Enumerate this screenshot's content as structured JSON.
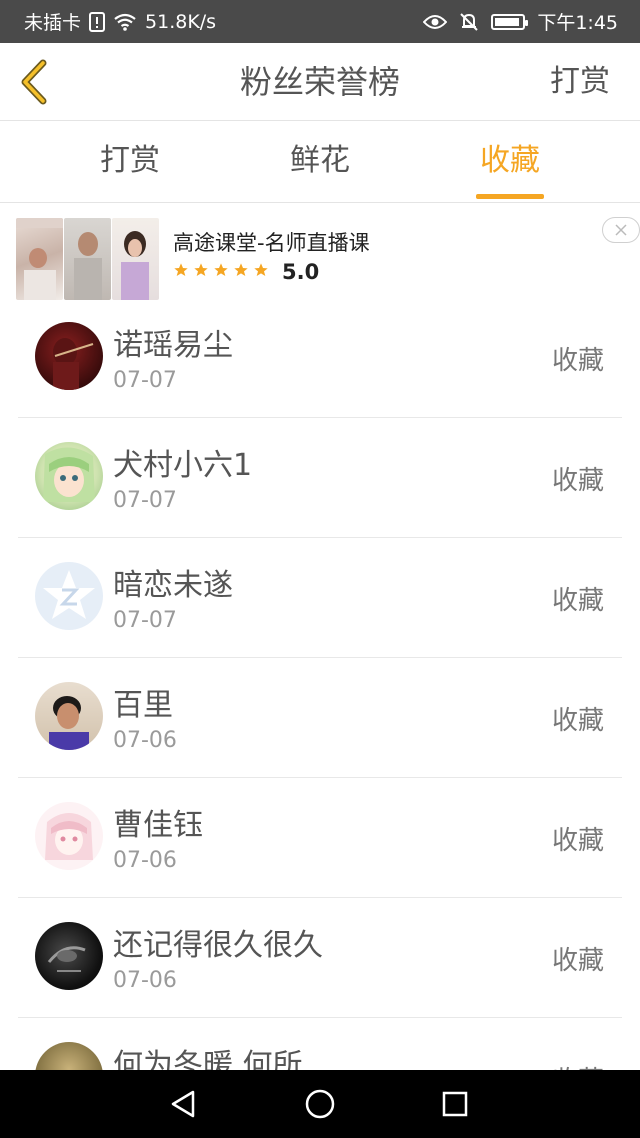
{
  "status_bar": {
    "carrier": "未插卡",
    "speed": "51.8K/s",
    "time": "下午1:45",
    "battery_level": 0.78
  },
  "header": {
    "title": "粉丝荣誉榜",
    "right_action": "打赏"
  },
  "tabs": [
    {
      "label": "打赏",
      "active": false
    },
    {
      "label": "鲜花",
      "active": false
    },
    {
      "label": "收藏",
      "active": true
    }
  ],
  "ad": {
    "title": "高途课堂-名师直播课",
    "rating": "5.0",
    "stars": 5
  },
  "list": [
    {
      "name": "诺瑶易尘",
      "date": "07-07",
      "action": "收藏"
    },
    {
      "name": "犬村小六1",
      "date": "07-07",
      "action": "收藏"
    },
    {
      "name": "暗恋未遂",
      "date": "07-07",
      "action": "收藏"
    },
    {
      "name": "百里",
      "date": "07-06",
      "action": "收藏"
    },
    {
      "name": "曹佳钰",
      "date": "07-06",
      "action": "收藏"
    },
    {
      "name": "还记得很久很久",
      "date": "07-06",
      "action": "收藏"
    },
    {
      "name": "何为冬暖 何所...",
      "date": "",
      "action": "收藏"
    }
  ],
  "colors": {
    "accent": "#f5a623",
    "status_bar": "#4a4a4a",
    "text": "#555555",
    "subtext": "#9a9a9a"
  }
}
